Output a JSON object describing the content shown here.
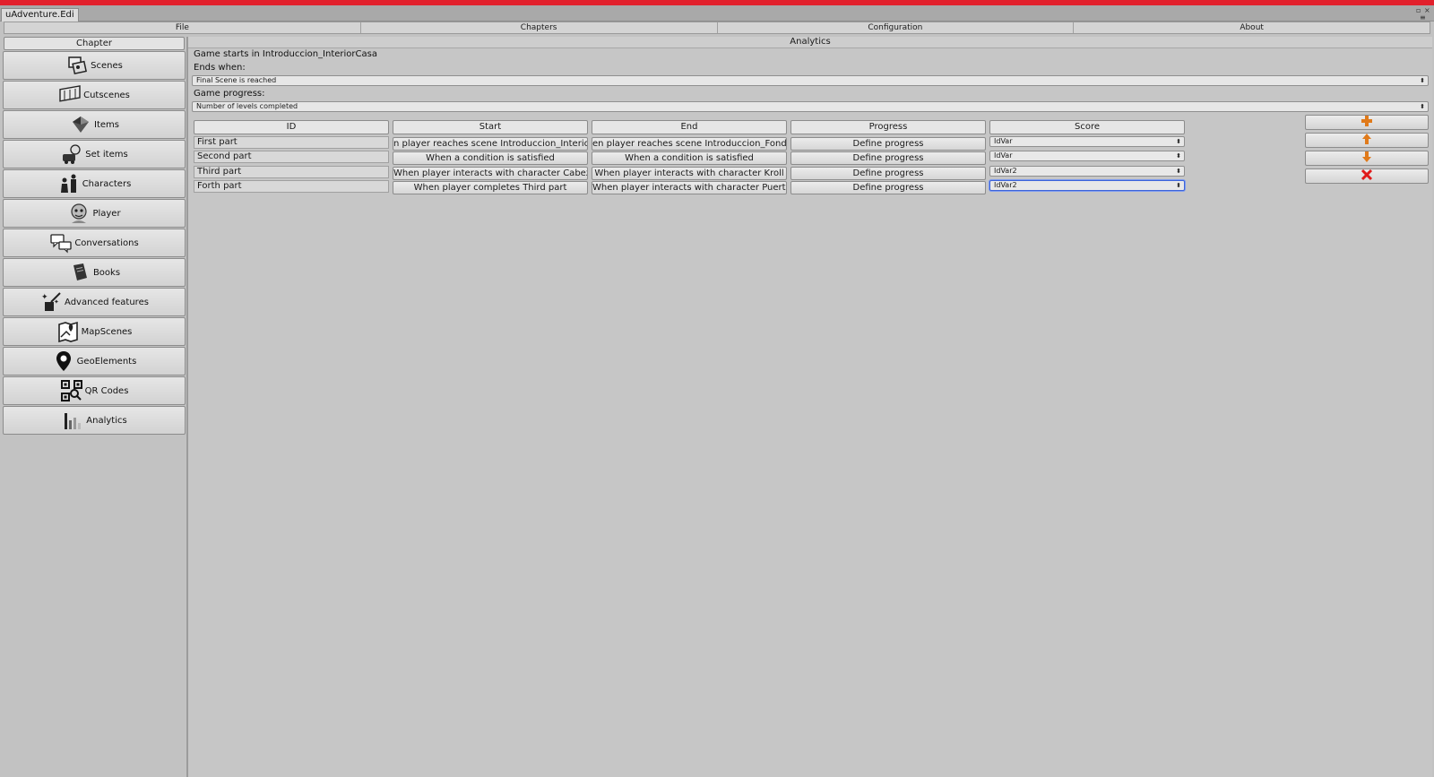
{
  "window": {
    "tab_title": "uAdventure.Edi",
    "controls": {
      "maximize": "▫",
      "close": "×",
      "menu": "≡"
    }
  },
  "menu": {
    "items": [
      {
        "label": "File"
      },
      {
        "label": "Chapters"
      },
      {
        "label": "Configuration"
      },
      {
        "label": "About"
      }
    ]
  },
  "sidebar": {
    "header": "Chapter",
    "items": [
      {
        "label": "Scenes",
        "icon": "scenes-icon"
      },
      {
        "label": "Cutscenes",
        "icon": "cutscenes-icon"
      },
      {
        "label": "Items",
        "icon": "items-icon"
      },
      {
        "label": "Set items",
        "icon": "set-items-icon"
      },
      {
        "label": "Characters",
        "icon": "characters-icon"
      },
      {
        "label": "Player",
        "icon": "player-icon"
      },
      {
        "label": "Conversations",
        "icon": "conversations-icon"
      },
      {
        "label": "Books",
        "icon": "books-icon"
      },
      {
        "label": "Advanced features",
        "icon": "advanced-features-icon"
      },
      {
        "label": "MapScenes",
        "icon": "map-icon"
      },
      {
        "label": "GeoElements",
        "icon": "geo-pin-icon"
      },
      {
        "label": "QR Codes",
        "icon": "qr-code-icon"
      },
      {
        "label": "Analytics",
        "icon": "analytics-icon"
      }
    ]
  },
  "main": {
    "title": "Analytics",
    "game_starts": "Game starts in Introduccion_InteriorCasa",
    "ends_when_label": "Ends when:",
    "ends_when_value": "Final Scene is reached",
    "progress_label": "Game progress:",
    "progress_value": "Number of levels completed",
    "table": {
      "columns": [
        "ID",
        "Start",
        "End",
        "Progress",
        "Score"
      ],
      "rows": [
        {
          "id": "First part",
          "start": "n player reaches scene Introduccion_Interior",
          "end": "en player reaches scene Introduccion_Fondo",
          "progress": "Define progress",
          "score": "IdVar"
        },
        {
          "id": "Second part",
          "start": "When a condition is satisfied",
          "end": "When a condition is satisfied",
          "progress": "Define progress",
          "score": "IdVar"
        },
        {
          "id": "Third part",
          "start": "When player interacts with character Cabeza",
          "end": "When player interacts with character Kroll",
          "progress": "Define progress",
          "score": "IdVar2"
        },
        {
          "id": "Forth part",
          "start": "When player completes Third part",
          "end": "When player interacts with character Puerta",
          "progress": "Define progress",
          "score": "IdVar2"
        }
      ]
    },
    "actions": [
      {
        "name": "add",
        "icon": "plus-icon",
        "color": "#e07a1a"
      },
      {
        "name": "move-up",
        "icon": "arrow-up-icon",
        "color": "#e07a1a"
      },
      {
        "name": "move-down",
        "icon": "arrow-down-icon",
        "color": "#e07a1a"
      },
      {
        "name": "delete",
        "icon": "delete-icon",
        "color": "#e01a1a"
      }
    ]
  },
  "colors": {
    "title_bar": "#e2202c",
    "background": "#c6c6c6",
    "active_select": "#3d63d8"
  }
}
